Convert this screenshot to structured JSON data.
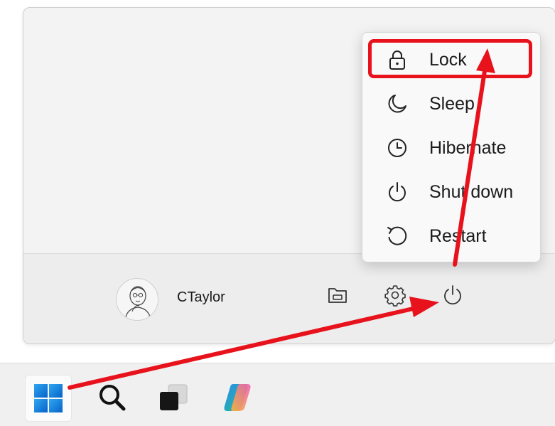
{
  "start_menu": {
    "user": {
      "name": "CTaylor",
      "avatar_icon": "user-avatar"
    },
    "footer_icons": [
      "documents-folder-icon",
      "settings-gear-icon",
      "power-icon"
    ]
  },
  "power_menu": {
    "items": [
      {
        "label": "Lock",
        "icon": "lock-icon"
      },
      {
        "label": "Sleep",
        "icon": "moon-icon"
      },
      {
        "label": "Hibernate",
        "icon": "clock-icon"
      },
      {
        "label": "Shut down",
        "icon": "power-icon"
      },
      {
        "label": "Restart",
        "icon": "restart-icon"
      }
    ]
  },
  "taskbar": {
    "items": [
      "windows-start-icon",
      "search-icon",
      "task-view-icon",
      "copilot-icon"
    ]
  },
  "annotations": {
    "highlight_color": "#e8121c",
    "highlighted_item": "Lock"
  },
  "colors": {
    "panel_bg": "#f3f3f3",
    "menu_bg": "#f9f9f9",
    "windows_blue": "#0a7fd9",
    "annotation_red": "#e8121c"
  }
}
